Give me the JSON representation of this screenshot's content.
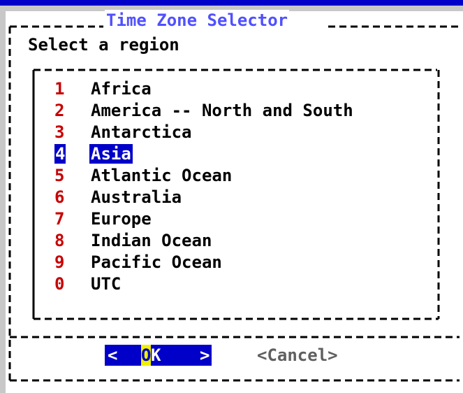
{
  "window": {
    "title": "Time Zone Selector",
    "prompt": "Select a region"
  },
  "regions": [
    {
      "num": "1",
      "label": "Africa"
    },
    {
      "num": "2",
      "label": "America -- North and South"
    },
    {
      "num": "3",
      "label": "Antarctica"
    },
    {
      "num": "4",
      "label": "Asia"
    },
    {
      "num": "5",
      "label": "Atlantic Ocean"
    },
    {
      "num": "6",
      "label": "Australia"
    },
    {
      "num": "7",
      "label": "Europe"
    },
    {
      "num": "8",
      "label": "Indian Ocean"
    },
    {
      "num": "9",
      "label": "Pacific Ocean"
    },
    {
      "num": "0",
      "label": "UTC"
    }
  ],
  "selected_region": "Asia",
  "buttons": {
    "ok": {
      "open": "<",
      "hotkey": "O",
      "rest": "K",
      "close": ">"
    },
    "cancel": "<Cancel>"
  },
  "colors": {
    "top_bar": "#0000c8",
    "dialog_shadow": "#c8c8c8",
    "title_text": "#5050ff",
    "number_text": "#c80000",
    "selection_bg": "#0000c8",
    "hotkey_bg": "#f0f000",
    "cancel_text": "#606060"
  }
}
